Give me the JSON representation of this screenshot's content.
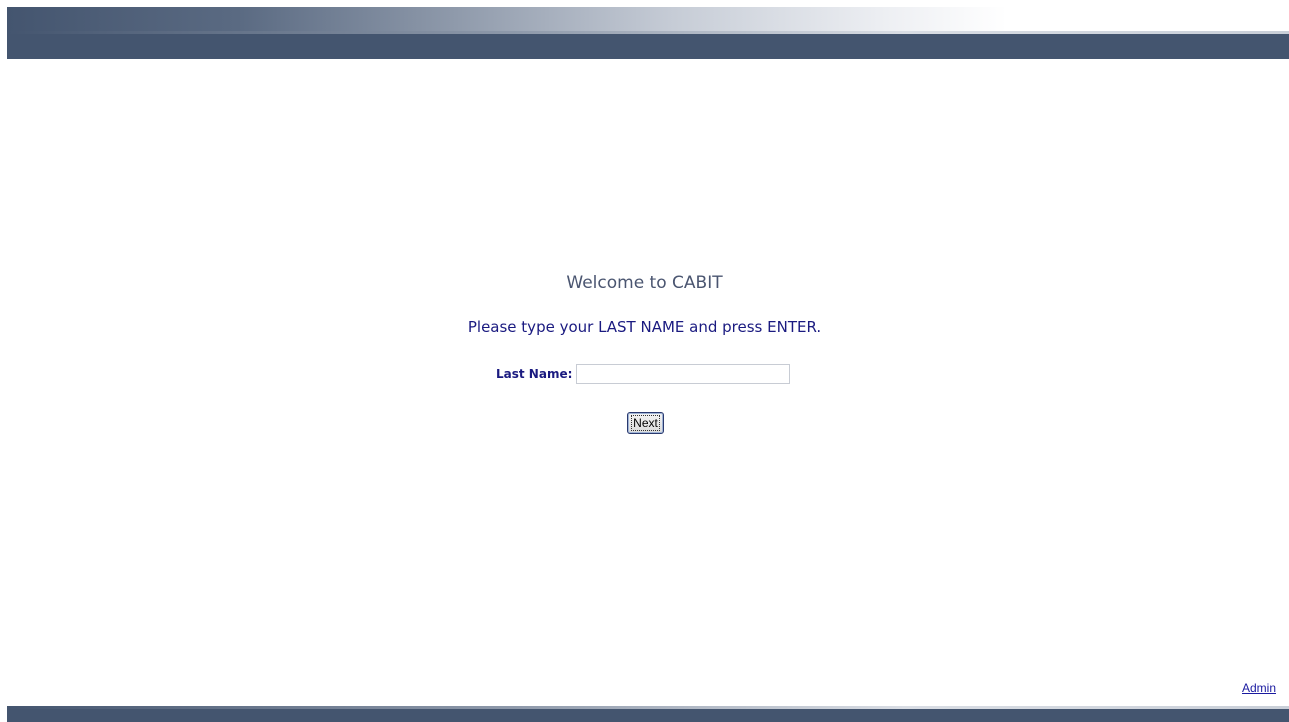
{
  "welcome": {
    "title": "Welcome to CABIT",
    "instruction": "Please type your LAST NAME and press ENTER."
  },
  "form": {
    "last_name_label": "Last Name:",
    "last_name_value": "",
    "next_label": "Next"
  },
  "footer": {
    "admin_label": "Admin"
  },
  "colors": {
    "banner": "#44556f",
    "text_navy": "#1a1a80",
    "welcome_text": "#4a5570"
  }
}
